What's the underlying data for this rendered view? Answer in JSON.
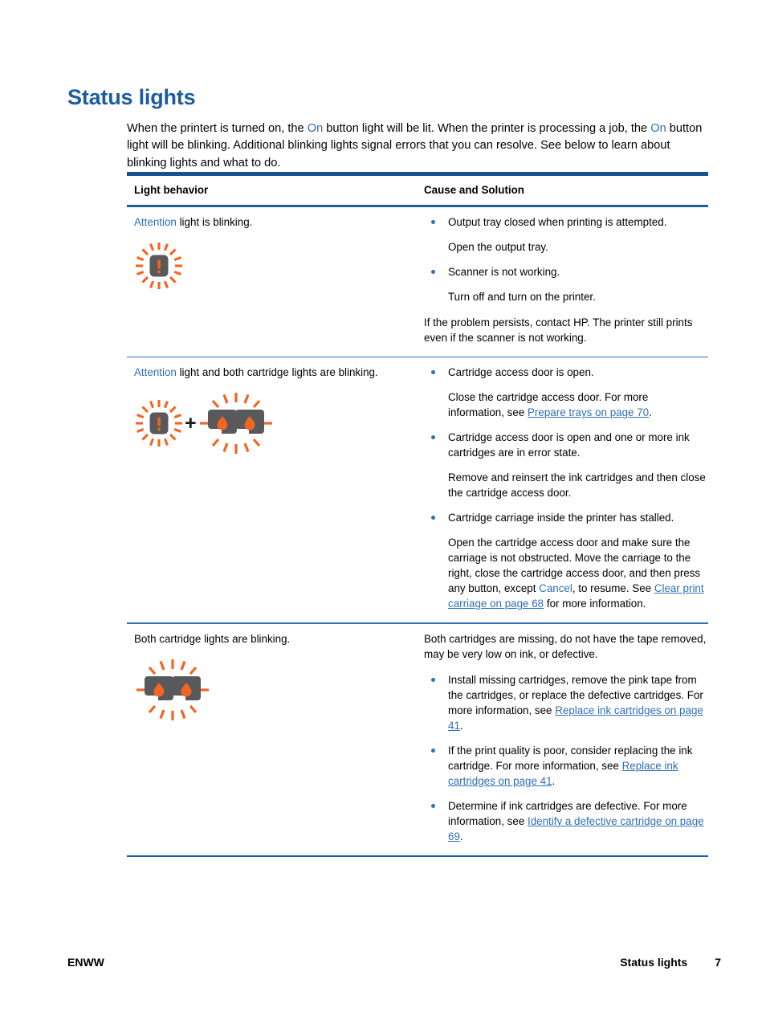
{
  "document": {
    "title": "Status lights",
    "intro": {
      "part1": "When the printert is turned on, the ",
      "link1": "On",
      "part2": " button light will be lit. When the printer is processing a job, the ",
      "link2": "On",
      "part3": " button light will be blinking. Additional blinking lights signal errors that you can resolve. See below to learn about blinking lights and what to do."
    }
  },
  "table": {
    "headers": {
      "col1": "Light behavior",
      "col2": "Cause and Solution"
    },
    "rows": [
      {
        "behavior_highlight": "Attention",
        "behavior_rest": " light is blinking.",
        "icon": "attention-light-blinking",
        "bullets": [
          {
            "main": "Output tray closed when printing is attempted.",
            "sub": "Open the output tray."
          },
          {
            "main": "Scanner is not working.",
            "sub": "Turn off and turn on the printer."
          }
        ],
        "trailing": "If the problem persists, contact HP. The printer still prints even if the scanner is not working."
      },
      {
        "behavior_highlight": "Attention",
        "behavior_rest": " light and both cartridge lights are blinking.",
        "icon": "attention-plus-two-cartridge-lights-blinking",
        "bullets": [
          {
            "main": "Cartridge access door is open.",
            "sub_pre": "Close the cartridge access door. For more information, see ",
            "sub_link": "Prepare trays on page 70",
            "sub_post": "."
          },
          {
            "main": "Cartridge access door is open and one or more ink cartridges are in error state.",
            "sub": "Remove and reinsert the ink cartridges and then close the cartridge access door."
          },
          {
            "main": "Cartridge carriage inside the printer has stalled.",
            "sub_pre": "Open the cartridge access door and make sure the carriage is not obstructed. Move the carriage to the right, close the cartridge access door, and then press any button, except ",
            "sub_mid_link": "Cancel",
            "sub_mid": ", to resume. See ",
            "sub_link": "Clear print carriage on page 68",
            "sub_post": " for more information."
          }
        ]
      },
      {
        "behavior_plain": "Both cartridge lights are blinking.",
        "icon": "two-cartridge-lights-blinking",
        "lead": "Both cartridges are missing, do not have the tape removed, may be very low on ink, or defective.",
        "bullets": [
          {
            "main_pre": "Install missing cartridges, remove the pink tape from the cartridges, or replace the defective cartridges. For more information, see ",
            "main_link": "Replace ink cartridges on page 41",
            "main_post": "."
          },
          {
            "main_pre": "If the print quality is poor, consider replacing the ink cartridge. For more information, see ",
            "main_link": "Replace ink cartridges on page 41",
            "main_post": "."
          },
          {
            "main_pre": "Determine if ink cartridges are defective. For more information, see ",
            "main_link": "Identify a defective cartridge on page 69",
            "main_post": "."
          }
        ]
      }
    ]
  },
  "footer": {
    "left": "ENWW",
    "section": "Status lights",
    "page_number": "7"
  },
  "colors": {
    "heading_blue": "#1d5c9e",
    "link_blue": "#2f6fb5",
    "rule_blue": "#15538f",
    "icon_orange": "#f26522",
    "icon_grey": "#58595b"
  }
}
